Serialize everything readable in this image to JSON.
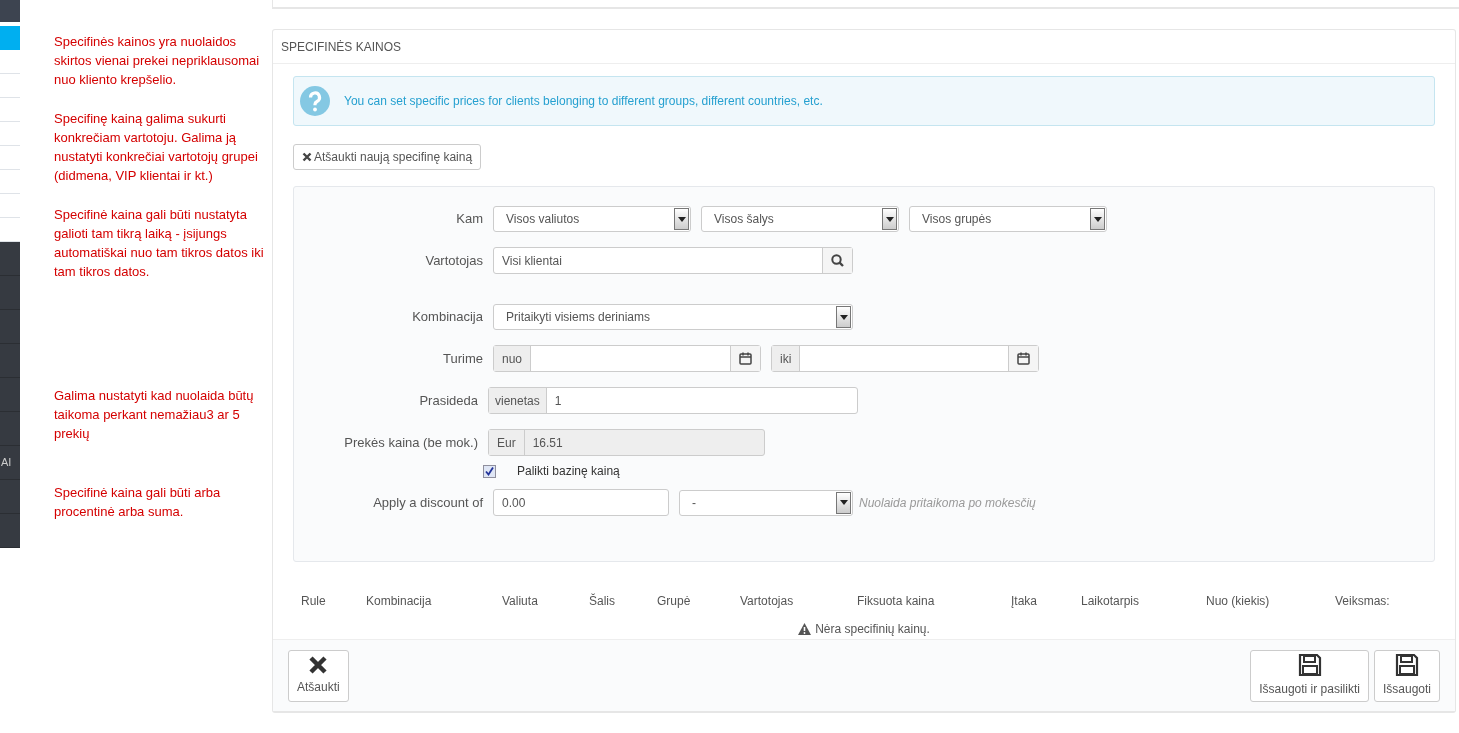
{
  "sidebar": {
    "items": [
      {
        "kind": "header"
      },
      {
        "kind": "sub",
        "selected": true
      },
      {
        "kind": "sub",
        "selected": false
      },
      {
        "kind": "sub",
        "selected": false
      },
      {
        "kind": "sub",
        "selected": false
      },
      {
        "kind": "sub",
        "selected": false
      },
      {
        "kind": "sub",
        "selected": false
      },
      {
        "kind": "sub",
        "selected": false
      },
      {
        "kind": "sub",
        "selected": false
      },
      {
        "kind": "sub",
        "selected": false
      },
      {
        "kind": "main",
        "selected": false
      },
      {
        "kind": "main",
        "selected": false
      },
      {
        "kind": "main",
        "selected": false
      },
      {
        "kind": "main",
        "selected": false
      },
      {
        "kind": "main",
        "selected": false
      },
      {
        "kind": "main",
        "selected": false
      },
      {
        "kind": "main",
        "selected": false,
        "label": "AI"
      },
      {
        "kind": "main",
        "selected": false
      },
      {
        "kind": "main",
        "selected": false
      }
    ]
  },
  "annotations": [
    {
      "text": "Specifinės kainos yra nuolaidos skirtos vienai prekei nepriklausomai nuo kliento krepšelio."
    },
    {
      "text": "Specifinę kainą galima sukurti konkrečiam vartotoju. Galima ją nustatyti konkrečiai vartotojų grupei (didmena, VIP klientai ir kt.)"
    },
    {
      "text": "Specifinė kaina gali būti nustatyta galioti tam tikrą laiką - įsijungs automatiškai nuo tam tikros datos iki tam tikros datos."
    },
    {
      "text": "Galima nustatyti kad nuolaida būtų taikoma perkant nemažiau3 ar 5 prekių"
    },
    {
      "text": "Specifinė kaina gali būti arba procentinė arba suma."
    }
  ],
  "panel": {
    "title": "SPECIFINĖS KAINOS",
    "info": "You can set specific prices for clients belonging to different groups, different countries, etc.",
    "cancel_new_button": "Atšaukti naują specifinę kainą",
    "form": {
      "kam": {
        "label": "Kam",
        "selects": [
          "Visos valiutos",
          "Visos šalys",
          "Visos grupės"
        ]
      },
      "vartotojas": {
        "label": "Vartotojas",
        "value": "Visi klientai"
      },
      "kombinacija": {
        "label": "Kombinacija",
        "value": "Pritaikyti visiems deriniams"
      },
      "turime": {
        "label": "Turime",
        "from_addon": "nuo",
        "to_addon": "iki"
      },
      "prasideda": {
        "label": "Prasideda",
        "addon": "vienetas",
        "value": "1"
      },
      "price": {
        "label": "Prekės kaina (be mok.)",
        "addon": "Eur",
        "value": "16.51",
        "disabled": true
      },
      "keep_base": {
        "label": "Palikti bazinę kainą",
        "checked": true
      },
      "discount": {
        "label": "Apply a discount of",
        "value": "0.00",
        "type_value": "-",
        "hint": "Nuolaida pritaikoma po mokesčių"
      }
    },
    "table": {
      "columns": [
        "Rule",
        "Kombinacija",
        "Valiuta",
        "Šalis",
        "Grupė",
        "Vartotojas",
        "Fiksuota kaina",
        "Įtaka",
        "Laikotarpis",
        "Nuo (kiekis)",
        "Veiksmas:"
      ],
      "empty": "Nėra specifinių kainų."
    },
    "footer": {
      "cancel": "Atšaukti",
      "save_stay": "Išsaugoti ir pasilikti",
      "save": "Išsaugoti"
    }
  }
}
